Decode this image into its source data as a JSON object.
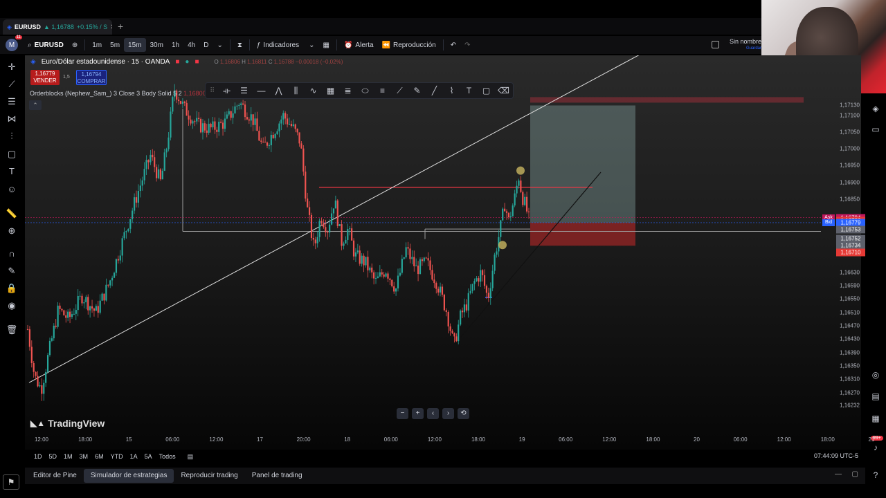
{
  "browser_tab": {
    "symbol": "EURUSD",
    "price": "▲ 1,16788",
    "change": "+0.15% / S",
    "close_label": "✕",
    "new_tab_label": "+"
  },
  "toolbar": {
    "avatar_letter": "M",
    "avatar_badge": "11",
    "symbol": "EURUSD",
    "intervals": [
      "1m",
      "5m",
      "15m",
      "30m",
      "1h",
      "4h",
      "D"
    ],
    "active_interval": "15m",
    "indicators_label": "Indicadores",
    "alert_label": "Alerta",
    "replay_label": "Reproducción",
    "layout_name": "Sin nombre",
    "layout_save": "Guardar"
  },
  "legend": {
    "title": "Euro/Dólar estadounidense · 15 · OANDA",
    "o_label": "O",
    "h_label": "H",
    "c_label": "C",
    "o_value": "1,16806",
    "h_value": "1,16811",
    "c_value": "1,16788 −0,00018 (−0,02%)",
    "sell_price": "1,16779",
    "sell_label": "VENDER",
    "spread": "1,5",
    "buy_price": "1,16794",
    "buy_label": "COMPRAR",
    "indicator": "Orderblocks (Nephew_Sam_) 3 Close 3 Body Solid 5 2",
    "indicator_value": "1,16800",
    "collapse_label": "⌃"
  },
  "price_scale": {
    "labels": [
      "1,17130",
      "1,17100",
      "1,17050",
      "1,17000",
      "1,16950",
      "1,16900",
      "1,16850",
      "1,16630",
      "1,16590",
      "1,16550",
      "1,16510",
      "1,16470",
      "1,16430",
      "1,16390",
      "1,16350",
      "1,16310",
      "1,16270",
      "1,16232"
    ],
    "ask_label": "Ask",
    "ask_price": "1,16794",
    "last_price": "1,16786",
    "countdown": "00:51",
    "bid_label": "Bid",
    "bid_price": "1,16779",
    "grey_prices": [
      "1,16753",
      "1,16752",
      "1,16734"
    ],
    "red_price": "1,16710"
  },
  "time_axis": {
    "labels": [
      "12:00",
      "18:00",
      "15",
      "06:00",
      "12:00",
      "17",
      "20:00",
      "18",
      "06:00",
      "12:00",
      "18:00",
      "19",
      "06:00",
      "12:00",
      "18:00",
      "20",
      "06:00",
      "12:00",
      "18:00",
      "21"
    ]
  },
  "chart": {
    "brand": "TradingView",
    "up_color": "#26a69a",
    "down_color": "#ef5350",
    "trendline_color": "#e0e0e0",
    "resistance_color": "#f23645",
    "position_target_color": "#b2dfdb",
    "position_stop_color": "#c62828"
  },
  "chart_data": {
    "type": "candlestick",
    "symbol": "EURUSD",
    "interval": "15",
    "ylim": [
      1.16232,
      1.1716
    ],
    "close_path": [
      [
        0.0,
        1.1646
      ],
      [
        0.01,
        1.1632
      ],
      [
        0.02,
        1.1628
      ],
      [
        0.03,
        1.1638
      ],
      [
        0.045,
        1.1652
      ],
      [
        0.06,
        1.1649
      ],
      [
        0.08,
        1.1656
      ],
      [
        0.1,
        1.1651
      ],
      [
        0.12,
        1.166
      ],
      [
        0.14,
        1.1673
      ],
      [
        0.16,
        1.1686
      ],
      [
        0.18,
        1.1698
      ],
      [
        0.195,
        1.169
      ],
      [
        0.205,
        1.1702
      ],
      [
        0.215,
        1.1718
      ],
      [
        0.23,
        1.1712
      ],
      [
        0.25,
        1.1707
      ],
      [
        0.27,
        1.1706
      ],
      [
        0.29,
        1.1708
      ],
      [
        0.31,
        1.1714
      ],
      [
        0.33,
        1.1709
      ],
      [
        0.345,
        1.17
      ],
      [
        0.36,
        1.1705
      ],
      [
        0.375,
        1.171
      ],
      [
        0.39,
        1.1706
      ],
      [
        0.4,
        1.1702
      ],
      [
        0.41,
        1.1682
      ],
      [
        0.42,
        1.167
      ],
      [
        0.43,
        1.168
      ],
      [
        0.44,
        1.1676
      ],
      [
        0.45,
        1.1685
      ],
      [
        0.46,
        1.1672
      ],
      [
        0.47,
        1.1676
      ],
      [
        0.48,
        1.1668
      ],
      [
        0.495,
        1.1666
      ],
      [
        0.51,
        1.166
      ],
      [
        0.525,
        1.1664
      ],
      [
        0.54,
        1.1658
      ],
      [
        0.555,
        1.167
      ],
      [
        0.57,
        1.1664
      ],
      [
        0.585,
        1.1666
      ],
      [
        0.6,
        1.166
      ],
      [
        0.615,
        1.1651
      ],
      [
        0.625,
        1.1641
      ],
      [
        0.635,
        1.165
      ],
      [
        0.645,
        1.1654
      ],
      [
        0.655,
        1.166
      ],
      [
        0.665,
        1.1663
      ],
      [
        0.675,
        1.1655
      ],
      [
        0.685,
        1.1668
      ],
      [
        0.695,
        1.1678
      ],
      [
        0.7,
        1.1684
      ],
      [
        0.705,
        1.1678
      ],
      [
        0.715,
        1.1686
      ],
      [
        0.72,
        1.1692
      ],
      [
        0.725,
        1.1686
      ],
      [
        0.73,
        1.1683
      ],
      [
        0.735,
        1.1679
      ]
    ]
  },
  "nav_buttons": [
    "−",
    "+",
    "‹",
    "›",
    "⟲"
  ],
  "range_bar": {
    "ranges": [
      "1D",
      "5D",
      "1M",
      "3M",
      "6M",
      "YTD",
      "1A",
      "5A",
      "Todos"
    ],
    "clock": "07:44:09 UTC-5"
  },
  "bottom_panel": {
    "tabs": [
      "Editor de Pine",
      "Simulador de estrategias",
      "Reproducir trading",
      "Panel de trading"
    ],
    "active_tab": "Simulador de estrategias"
  },
  "icons": {
    "left": [
      "crosshair-icon",
      "trendline-icon",
      "fib-icon",
      "pattern-icon",
      "projection-icon",
      "shapes-icon",
      "text-icon",
      "emoji-icon",
      "ruler-icon",
      "zoom-icon",
      "magnet-icon",
      "lock-drawing-icon",
      "lock-icon",
      "eye-icon",
      "trash-icon"
    ],
    "right": [
      "layers-icon",
      "chat-icon",
      "target-icon",
      "calendar-icon",
      "grid-icon",
      "bell-icon",
      "help-icon"
    ]
  },
  "notification_badge": "99+"
}
